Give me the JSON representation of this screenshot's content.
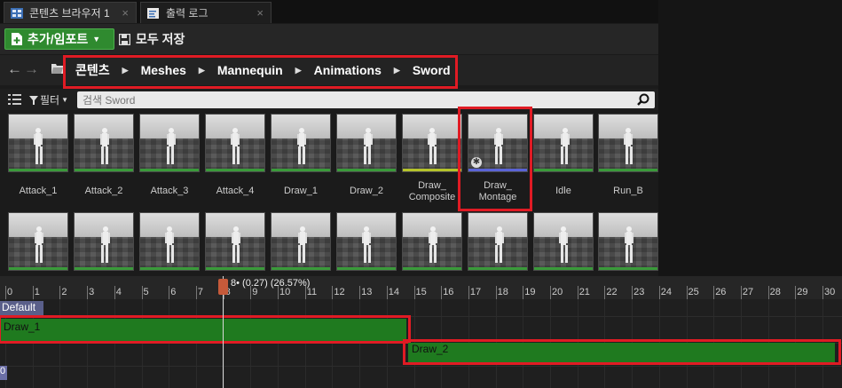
{
  "tabs": [
    {
      "label": "콘텐츠 브라우저 1"
    },
    {
      "label": "출력 로그"
    }
  ],
  "toolbar": {
    "add_import_label": "추가/임포트",
    "save_all_label": "모두 저장"
  },
  "breadcrumb": {
    "items": [
      "콘텐츠",
      "Meshes",
      "Mannequin",
      "Animations",
      "Sword"
    ]
  },
  "filter": {
    "label": "필터",
    "search_placeholder": "검색 Sword"
  },
  "assets": {
    "row1": [
      {
        "name": "Attack_1",
        "type": "sequence"
      },
      {
        "name": "Attack_2",
        "type": "sequence"
      },
      {
        "name": "Attack_3",
        "type": "sequence"
      },
      {
        "name": "Attack_4",
        "type": "sequence"
      },
      {
        "name": "Draw_1",
        "type": "sequence"
      },
      {
        "name": "Draw_2",
        "type": "sequence"
      },
      {
        "name": "Draw_\nComposite",
        "type": "composite"
      },
      {
        "name": "Draw_\nMontage",
        "type": "montage"
      },
      {
        "name": "Idle",
        "type": "sequence"
      },
      {
        "name": "Run_B",
        "type": "sequence"
      }
    ],
    "row2_count": 10
  },
  "timeline": {
    "ticks": [
      "0",
      "1",
      "2",
      "3",
      "4",
      "5",
      "6",
      "7",
      "8",
      "9",
      "10",
      "11",
      "12",
      "13",
      "14",
      "15",
      "16",
      "17",
      "18",
      "19",
      "20",
      "21",
      "22",
      "23",
      "24",
      "25",
      "26",
      "27",
      "28",
      "29",
      "30"
    ],
    "playhead_label": "8• (0.27) (26.57%)",
    "slot_label": "Default",
    "segments": [
      {
        "label": "Draw_1",
        "start": 0,
        "end": 15
      },
      {
        "label": "Draw_2",
        "start": 15,
        "end": 30.5
      }
    ],
    "stub_label": "0"
  },
  "colors": {
    "accent_green": "#2f8a2f",
    "highlight_red": "#e01b24",
    "segment_green": "#1f7a1f",
    "montage_blue": "#5a63d6",
    "composite_yellow": "#b5c32a"
  }
}
